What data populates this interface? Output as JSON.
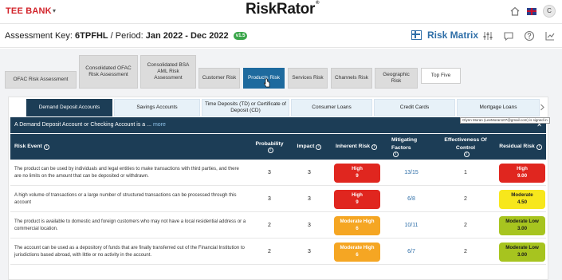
{
  "header": {
    "bank_name": "TEE BANK",
    "caret": "▾",
    "app_title": "RiskRator",
    "trademark": "®",
    "icons": [
      "home-icon",
      "flag-icon",
      "avatar"
    ],
    "avatar_initial": "C"
  },
  "assessment": {
    "key_label": "Assessment Key:",
    "key_value": "6TPFHL",
    "period_label": "/ Period:",
    "period_value": "Jan 2022 - Dec 2022",
    "version": "v1.5",
    "section_title": "Risk Matrix",
    "icons": [
      "sliders-icon",
      "chat-icon",
      "help-icon",
      "chart-icon"
    ]
  },
  "assessment_tabs": [
    {
      "label": "OFAC Risk Assessment"
    },
    {
      "label": "Consolidated OFAC Risk Assessment"
    },
    {
      "label": "Consolidated BSA AML Risk Assessment"
    },
    {
      "label": "Customer Risk"
    },
    {
      "label": "Products Risk"
    },
    {
      "label": "Services Risk"
    },
    {
      "label": "Channels Risk"
    },
    {
      "label": "Geographic Risk"
    },
    {
      "label": "Top Five"
    }
  ],
  "product_tabs": [
    {
      "label": "Demand Deposit Accounts"
    },
    {
      "label": "Savings Accounts"
    },
    {
      "label": "Time Deposits (TD) or Certificate of Deposit (CD)"
    },
    {
      "label": "Consumer Loans"
    },
    {
      "label": "Credit Cards"
    },
    {
      "label": "Mortgage Loans"
    }
  ],
  "tooltip": "Glynn Moran (LeeMoran107@gmail.com) is signed in",
  "description": {
    "text": "A Demand Deposit Account or Checking Account is a ...",
    "more_link": "more",
    "close": "✕"
  },
  "table": {
    "info_icon": "ⓘ",
    "headers": {
      "risk_event": "Risk Event",
      "probability": "Probability",
      "impact": "Impact",
      "inherent_risk": "Inherent Risk",
      "mitigating_factors": "Mitigating Factors",
      "effectiveness": "Effectiveness Of Control",
      "residual_risk": "Residual Risk"
    },
    "rows": [
      {
        "event": "The product can be used by individuals and legal entities to make transactions with third parties, and there are no limits on the amount that can be deposited or withdrawn.",
        "probability": "3",
        "impact": "3",
        "inherent_label": "High",
        "inherent_value": "9",
        "mitigating": "13/15",
        "effectiveness": "1",
        "residual_label": "High",
        "residual_value": "9.00"
      },
      {
        "event": "A high volume of transactions or a large number of structured transactions can be processed through this account",
        "probability": "3",
        "impact": "3",
        "inherent_label": "High",
        "inherent_value": "9",
        "mitigating": "6/8",
        "effectiveness": "2",
        "residual_label": "Moderate",
        "residual_value": "4.50"
      },
      {
        "event": "The product is available to domestic and foreign customers who may not have a local residential address or a commercial location.",
        "probability": "2",
        "impact": "3",
        "inherent_label": "Moderate High",
        "inherent_value": "6",
        "mitigating": "10/11",
        "effectiveness": "2",
        "residual_label": "Moderate Low",
        "residual_value": "3.00"
      },
      {
        "event": "The account can be used as a depository of funds that are finally transferred out of the Financial Institution to jurisdictions based abroad, with little or no activity in the account.",
        "probability": "2",
        "impact": "3",
        "inherent_label": "Moderate High",
        "inherent_value": "6",
        "mitigating": "6/7",
        "effectiveness": "2",
        "residual_label": "Moderate Low",
        "residual_value": "3.00"
      }
    ]
  },
  "colors": {
    "brand_red": "#d2232a",
    "accent_blue": "#2f6fa8",
    "header_navy": "#1c3d56",
    "high": "#e0261f",
    "moderate_high": "#f5a623",
    "moderate": "#f7e71c",
    "moderate_low": "#a7c41f"
  }
}
